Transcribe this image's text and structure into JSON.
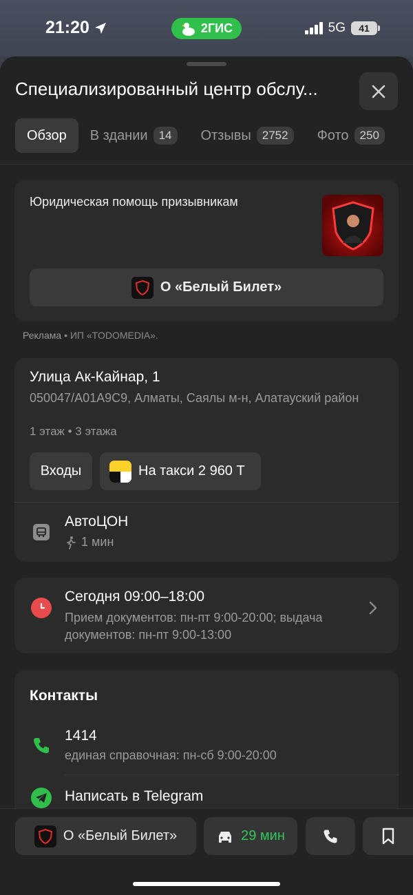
{
  "status_bar": {
    "time": "21:20",
    "app_badge": "2ГИС",
    "network": "5G",
    "battery": "41"
  },
  "header": {
    "title": "Специализированный центр обслу..."
  },
  "tabs": [
    {
      "label": "Обзор",
      "count": null
    },
    {
      "label": "В здании",
      "count": "14"
    },
    {
      "label": "Отзывы",
      "count": "2752"
    },
    {
      "label": "Фото",
      "count": "250"
    }
  ],
  "ad": {
    "text": "Юридическая помощь призывникам",
    "button_label": "О «Белый Билет»",
    "note_prefix": "Реклама",
    "note_advertiser": "ИП «TODOMEDIA»."
  },
  "address": {
    "street": "Улица Ак-Кайнар, 1",
    "details": "050047/A01A9C9, Алматы, Саялы м-н, Алатауский район",
    "floors": "1 этаж • 3 этажа",
    "entrances_label": "Входы",
    "taxi_label": "На такси 2 960 Т",
    "transit_name": "АвтоЦОН",
    "transit_walk": "1 мин"
  },
  "hours": {
    "today": "Сегодня 09:00–18:00",
    "note": "Прием документов: пн-пт 9:00-20:00; выдача документов: пн-пт 9:00-13:00"
  },
  "contacts": {
    "title": "Контакты",
    "phone": "1414",
    "phone_note": "единая справочная: пн-сб 9:00-20:00",
    "telegram_label": "Написать в Telegram"
  },
  "bottom_bar": {
    "company_label": "О «Белый Билет»",
    "route_time": "29 мин"
  },
  "colors": {
    "accent_green": "#2fbf4a",
    "clock_red": "#e84b4b",
    "brand_red": "#c81515"
  },
  "icons": [
    "location-arrow-icon",
    "2gis-logo-icon",
    "close-icon",
    "shield-logo-icon",
    "bus-icon",
    "walk-icon",
    "chevron-right-icon",
    "clock-icon",
    "phone-icon",
    "telegram-icon",
    "car-icon",
    "bookmark-icon"
  ]
}
